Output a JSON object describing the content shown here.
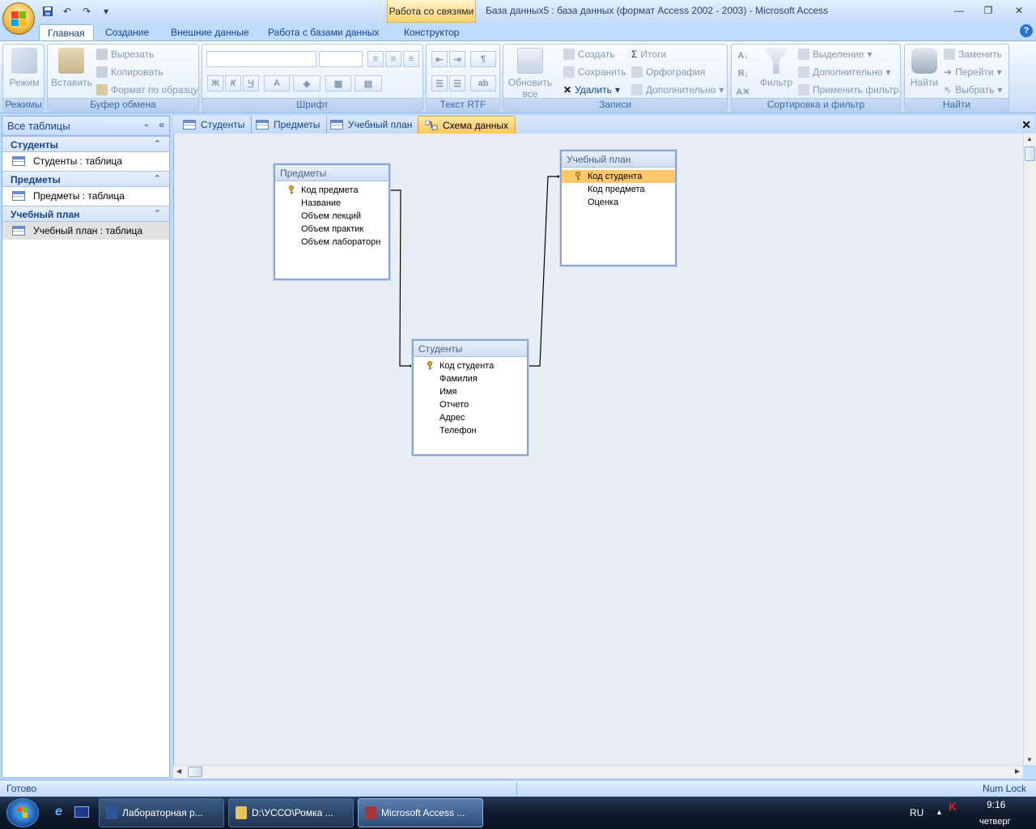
{
  "window": {
    "context_tab": "Работа со связями",
    "title": "База данных5 : база данных (формат Access 2002 - 2003) - Microsoft Access"
  },
  "ribbon_tabs": [
    "Главная",
    "Создание",
    "Внешние данные",
    "Работа с базами данных",
    "Конструктор"
  ],
  "ribbon": {
    "modes": {
      "view": "Режим",
      "label": "Режимы"
    },
    "clipboard": {
      "paste": "Вставить",
      "cut": "Вырезать",
      "copy": "Копировать",
      "format_painter": "Формат по образцу",
      "label": "Буфер обмена"
    },
    "font": {
      "bold": "Ж",
      "italic": "К",
      "underline": "Ч",
      "label": "Шрифт"
    },
    "rtf": {
      "label": "Текст RTF"
    },
    "records": {
      "refresh": "Обновить",
      "refresh2": "все",
      "new": "Создать",
      "save": "Сохранить",
      "delete": "Удалить",
      "totals": "Итоги",
      "spelling": "Орфография",
      "more": "Дополнительно",
      "label": "Записи"
    },
    "sort": {
      "filter": "Фильтр",
      "selection": "Выделение",
      "advanced": "Дополнительно",
      "toggle": "Применить фильтр",
      "label": "Сортировка и фильтр"
    },
    "find": {
      "find": "Найти",
      "replace": "Заменить",
      "goto": "Перейти",
      "select": "Выбрать",
      "label": "Найти"
    }
  },
  "nav": {
    "header": "Все таблицы",
    "groups": [
      {
        "name": "Студенты",
        "item": "Студенты : таблица"
      },
      {
        "name": "Предметы",
        "item": "Предметы : таблица"
      },
      {
        "name": "Учебный план",
        "item": "Учебный план : таблица"
      }
    ]
  },
  "doc_tabs": [
    "Студенты",
    "Предметы",
    "Учебный план",
    "Схема данных"
  ],
  "tables": {
    "predmety": {
      "title": "Предметы",
      "fields": [
        "Код предмета",
        "Название",
        "Объем лекций",
        "Объем практик",
        "Объем лабораторн"
      ]
    },
    "plan": {
      "title": "Учебный план",
      "fields": [
        "Код студента",
        "Код предмета",
        "Оценка"
      ]
    },
    "studenty": {
      "title": "Студенты",
      "fields": [
        "Код студента",
        "Фамилия",
        "Имя",
        "Отчето",
        "Адрес",
        "Телефон"
      ]
    }
  },
  "status": {
    "left": "Готово",
    "right": "Num Lock"
  },
  "taskbar": {
    "buttons": [
      "Лабораторная р...",
      "D:\\УССО\\Ромка ...",
      "Microsoft Access ..."
    ],
    "lang": "RU",
    "time": "9:16",
    "day": "четверг"
  }
}
